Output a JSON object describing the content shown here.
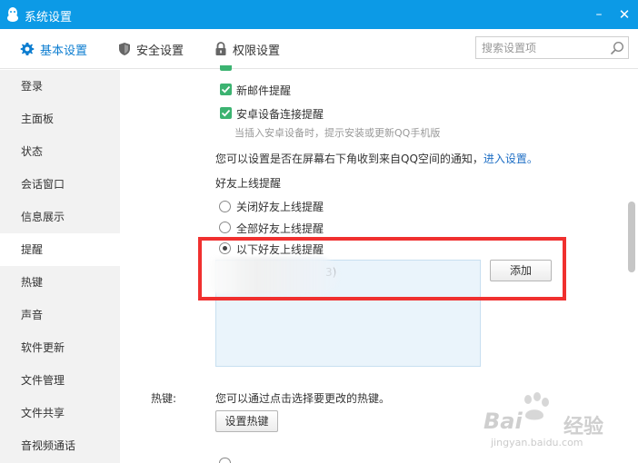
{
  "window": {
    "title": "系统设置",
    "minimize_symbol": "–",
    "close_symbol": "✕"
  },
  "tabs": [
    {
      "label": "基本设置",
      "icon": "gear-icon",
      "active": true
    },
    {
      "label": "安全设置",
      "icon": "shield-icon",
      "active": false
    },
    {
      "label": "权限设置",
      "icon": "lock-icon",
      "active": false
    }
  ],
  "search": {
    "placeholder": "搜索设置项",
    "value": ""
  },
  "sidebar": {
    "items": [
      {
        "label": "登录"
      },
      {
        "label": "主面板"
      },
      {
        "label": "状态"
      },
      {
        "label": "会话窗口"
      },
      {
        "label": "信息展示"
      },
      {
        "label": "提醒",
        "active": true
      },
      {
        "label": "热键"
      },
      {
        "label": "声音"
      },
      {
        "label": "软件更新"
      },
      {
        "label": "文件管理"
      },
      {
        "label": "文件共享"
      },
      {
        "label": "音视频通话"
      }
    ]
  },
  "reminder": {
    "checkbox_new_mail": "新邮件提醒",
    "checkbox_android": "安卓设备连接提醒",
    "android_hint": "当插入安卓设备时，提示安装或更新QQ手机版",
    "qzone_text": "您可以设置是否在屏幕右下角收到来自QQ空间的通知，",
    "qzone_link": "进入设置。",
    "friend_online_title": "好友上线提醒",
    "radio_off": "关闭好友上线提醒",
    "radio_all": "全部好友上线提醒",
    "radio_some": "以下好友上线提醒",
    "friend_entry_suffix": "3)",
    "add_button": "添加"
  },
  "hotkey": {
    "label": "热键:",
    "text": "您可以通过点击选择要更改的热键。",
    "button": "设置热键"
  },
  "watermark": {
    "brand_en": "Bai",
    "brand_cn": "经验",
    "url": "jingyan.baidu.com"
  },
  "colors": {
    "titlebar": "#0c9ae6",
    "accent": "#0c7dd0",
    "checkbox": "#3cb371",
    "highlight": "#f0302f",
    "link": "#1f6fc5"
  }
}
